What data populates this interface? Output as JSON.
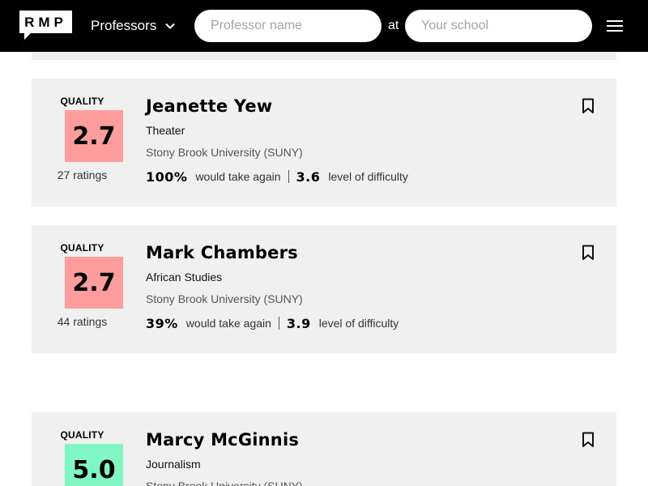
{
  "header": {
    "logo_text": "RMP",
    "type_select_label": "Professors",
    "professor_placeholder": "Professor name",
    "at_text": "at",
    "school_placeholder": "Your school"
  },
  "colors": {
    "low_quality": "#ff9c9c",
    "high_quality": "#7ff6c3",
    "card_bg": "#f0f0f0"
  },
  "professors": [
    {
      "quality_label": "QUALITY",
      "score": "2.7",
      "ratings": "27 ratings",
      "name": "Jeanette Yew",
      "department": "Theater",
      "school": "Stony Brook University (SUNY)",
      "would_take_again_pct": "100%",
      "would_take_again_text": "would take again",
      "difficulty": "3.6",
      "difficulty_text": "level of difficulty"
    },
    {
      "quality_label": "QUALITY",
      "score": "2.7",
      "ratings": "44 ratings",
      "name": "Mark Chambers",
      "department": "African Studies",
      "school": "Stony Brook University (SUNY)",
      "would_take_again_pct": "39%",
      "would_take_again_text": "would take again",
      "difficulty": "3.9",
      "difficulty_text": "level of difficulty"
    },
    {
      "quality_label": "QUALITY",
      "score": "5.0",
      "name": "Marcy McGinnis",
      "department": "Journalism",
      "school": "Stony Brook University (SUNY)"
    }
  ]
}
